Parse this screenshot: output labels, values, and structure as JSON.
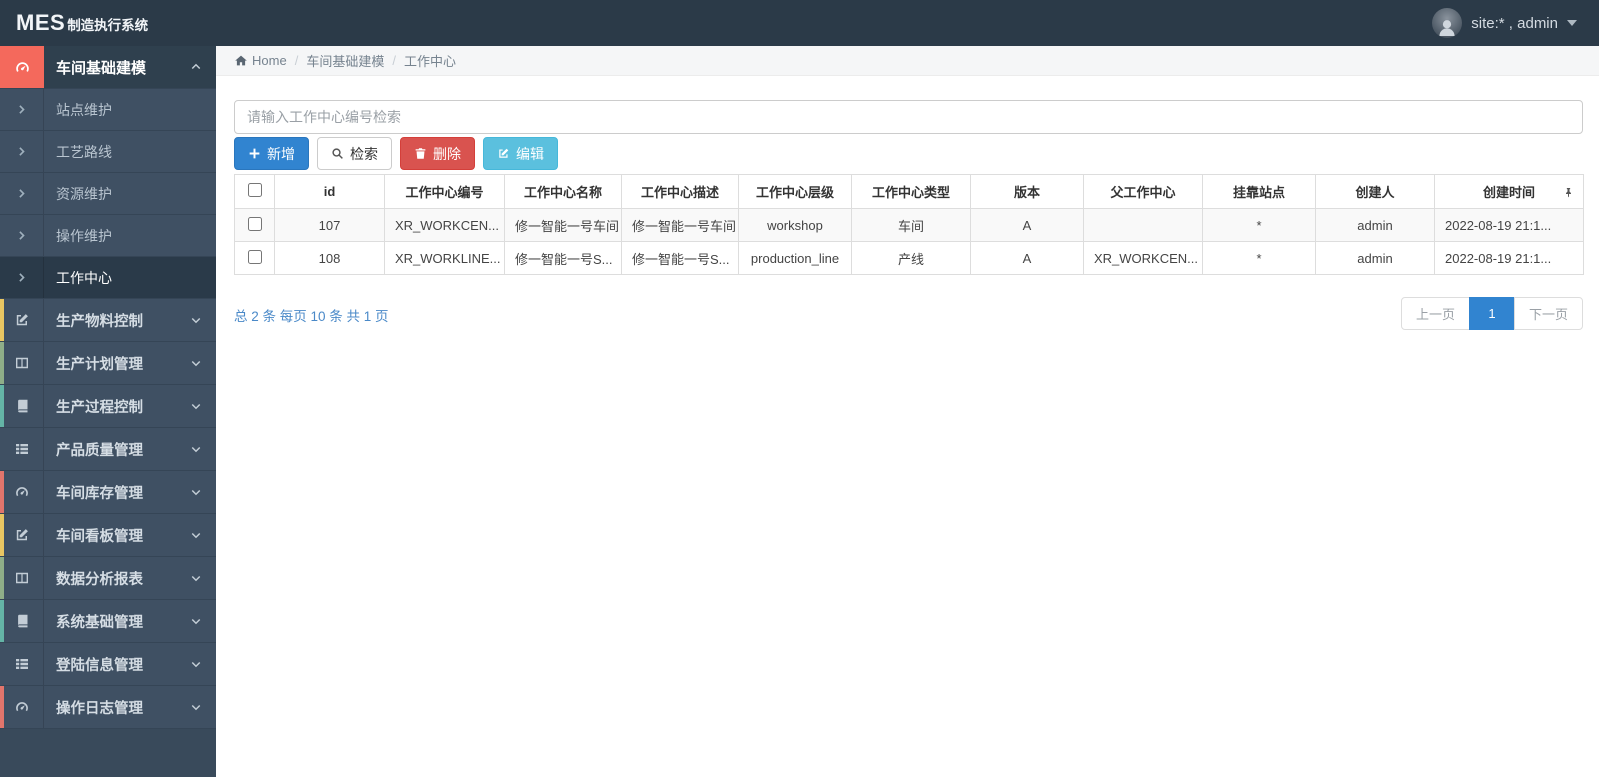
{
  "topbar": {
    "logo_primary": "MES",
    "logo_secondary": "制造执行系统",
    "user_label": "site:* , admin"
  },
  "breadcrumb": {
    "home_label": "Home",
    "level1": "车间基础建模",
    "level2": "工作中心"
  },
  "sidebar": {
    "group": {
      "label": "车间基础建模",
      "icon": "dashboard-icon"
    },
    "subitems": [
      {
        "label": "站点维护"
      },
      {
        "label": "工艺路线"
      },
      {
        "label": "资源维护"
      },
      {
        "label": "操作维护"
      },
      {
        "label": "工作中心",
        "active": true
      }
    ],
    "items": [
      {
        "label": "生产物料控制",
        "icon": "edit-icon",
        "accent": "#e9c662"
      },
      {
        "label": "生产计划管理",
        "icon": "columns-icon",
        "accent": "#8fae88"
      },
      {
        "label": "生产过程控制",
        "icon": "book-icon",
        "accent": "#64b4a6"
      },
      {
        "label": "产品质量管理",
        "icon": "list-icon",
        "accent": ""
      },
      {
        "label": "车间库存管理",
        "icon": "dashboard-icon",
        "accent": "#e2756c"
      },
      {
        "label": "车间看板管理",
        "icon": "edit-icon",
        "accent": "#e9c662"
      },
      {
        "label": "数据分析报表",
        "icon": "columns-icon",
        "accent": "#8fae88"
      },
      {
        "label": "系统基础管理",
        "icon": "book-icon",
        "accent": "#64b4a6"
      },
      {
        "label": "登陆信息管理",
        "icon": "list-icon",
        "accent": ""
      },
      {
        "label": "操作日志管理",
        "icon": "dashboard-icon",
        "accent": "#e2756c"
      }
    ]
  },
  "filters": {
    "search_placeholder": "请输入工作中心编号检索"
  },
  "toolbar": {
    "add_label": "新增",
    "search_label": "检索",
    "delete_label": "删除",
    "edit_label": "编辑"
  },
  "table": {
    "headers": [
      "id",
      "工作中心编号",
      "工作中心名称",
      "工作中心描述",
      "工作中心层级",
      "工作中心类型",
      "版本",
      "父工作中心",
      "挂靠站点",
      "创建人",
      "创建时间"
    ],
    "rows": [
      {
        "cells": [
          "107",
          "XR_WORKCEN...",
          "修一智能一号车间",
          "修一智能一号车间",
          "workshop",
          "车间",
          "A",
          "",
          "*",
          "admin",
          "2022-08-19 21:1..."
        ]
      },
      {
        "cells": [
          "108",
          "XR_WORKLINE...",
          "修一智能一号S...",
          "修一智能一号S...",
          "production_line",
          "产线",
          "A",
          "XR_WORKCEN...",
          "*",
          "admin",
          "2022-08-19 21:1..."
        ]
      }
    ]
  },
  "pagination": {
    "summary": "总 2 条 每页 10 条 共 1 页",
    "prev_label": "上一页",
    "current_page": "1",
    "next_label": "下一页"
  },
  "colors": {
    "topbar_bg": "#2b3a48",
    "sidebar_bg": "#3f5063",
    "active_group_icon_bg": "#f4695c",
    "primary_blue": "#3184d0",
    "danger_red": "#d9534f",
    "info_cyan": "#5bc0de",
    "summary_blue": "#4a89c8",
    "accent_yellow": "#e9c662",
    "accent_green": "#8fae88",
    "accent_teal": "#64b4a6",
    "accent_red": "#e2756c"
  }
}
